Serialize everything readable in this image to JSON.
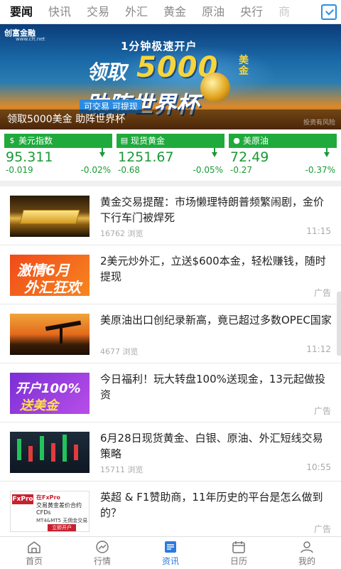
{
  "tabs": [
    "要闻",
    "快讯",
    "交易",
    "外汇",
    "黄金",
    "原油",
    "央行",
    "商"
  ],
  "banner": {
    "logo": "创富金融",
    "logo_url": "www.cft.net",
    "line1": "1分钟极速开户",
    "line2_prefix": "领取",
    "line2_amount": "5000",
    "line2_unit": "美金",
    "line3": "助阵世界杯",
    "subtitle": "可交易 可提现",
    "caption": "领取5000美金 助阵世界杯",
    "watermark": "投资有风险"
  },
  "quotes": [
    {
      "name": "美元指数",
      "icon": "dollar-icon",
      "price": "95.311",
      "change": "-0.019",
      "percent": "-0.02%"
    },
    {
      "name": "现货黄金",
      "icon": "gold-bars-icon",
      "price": "1251.67",
      "change": "-0.68",
      "percent": "-0.05%"
    },
    {
      "name": "美原油",
      "icon": "oil-drop-icon",
      "price": "72.49",
      "change": "-0.27",
      "percent": "-0.37%"
    }
  ],
  "news": [
    {
      "title": "黄金交易提醒：市场懒理特朗普频繁闹剧，金价下行车门被焊死",
      "views": "16762 浏览",
      "time": "11:15",
      "thumb": "gold"
    },
    {
      "title": "2美元炒外汇，立送$600本金，轻松赚钱，随时提现",
      "ad": "广告",
      "thumb": "orange",
      "thumb_text": [
        "激情6月",
        "外汇狂欢"
      ]
    },
    {
      "title": "美原油出口创纪录新高，竟已超过多数OPEC国家",
      "views": "4677 浏览",
      "time": "11:12",
      "thumb": "oil"
    },
    {
      "title": "今日福利！玩大转盘100%送现金，13元起做投资",
      "ad": "广告",
      "thumb": "purple",
      "thumb_text": [
        "开户100%",
        "送美金"
      ]
    },
    {
      "title": "6月28日现货黄金、白银、原油、外汇短线交易策略",
      "views": "15711 浏览",
      "time": "10:55",
      "thumb": "chart"
    },
    {
      "title": "英超 & F1赞助商，11年历史的平台是怎么做到的？",
      "ad": "广告",
      "thumb": "fx",
      "thumb_text": [
        "FxPro",
        "在FxPro",
        "交易黄金差价合约",
        "CFDs",
        "MT4&MT5 无佣金交易",
        "立即开户"
      ]
    }
  ],
  "bottom_nav": [
    {
      "label": "首页",
      "icon": "home-icon"
    },
    {
      "label": "行情",
      "icon": "trend-icon"
    },
    {
      "label": "资讯",
      "icon": "news-icon",
      "active": true
    },
    {
      "label": "日历",
      "icon": "calendar-icon"
    },
    {
      "label": "我的",
      "icon": "user-icon"
    }
  ]
}
